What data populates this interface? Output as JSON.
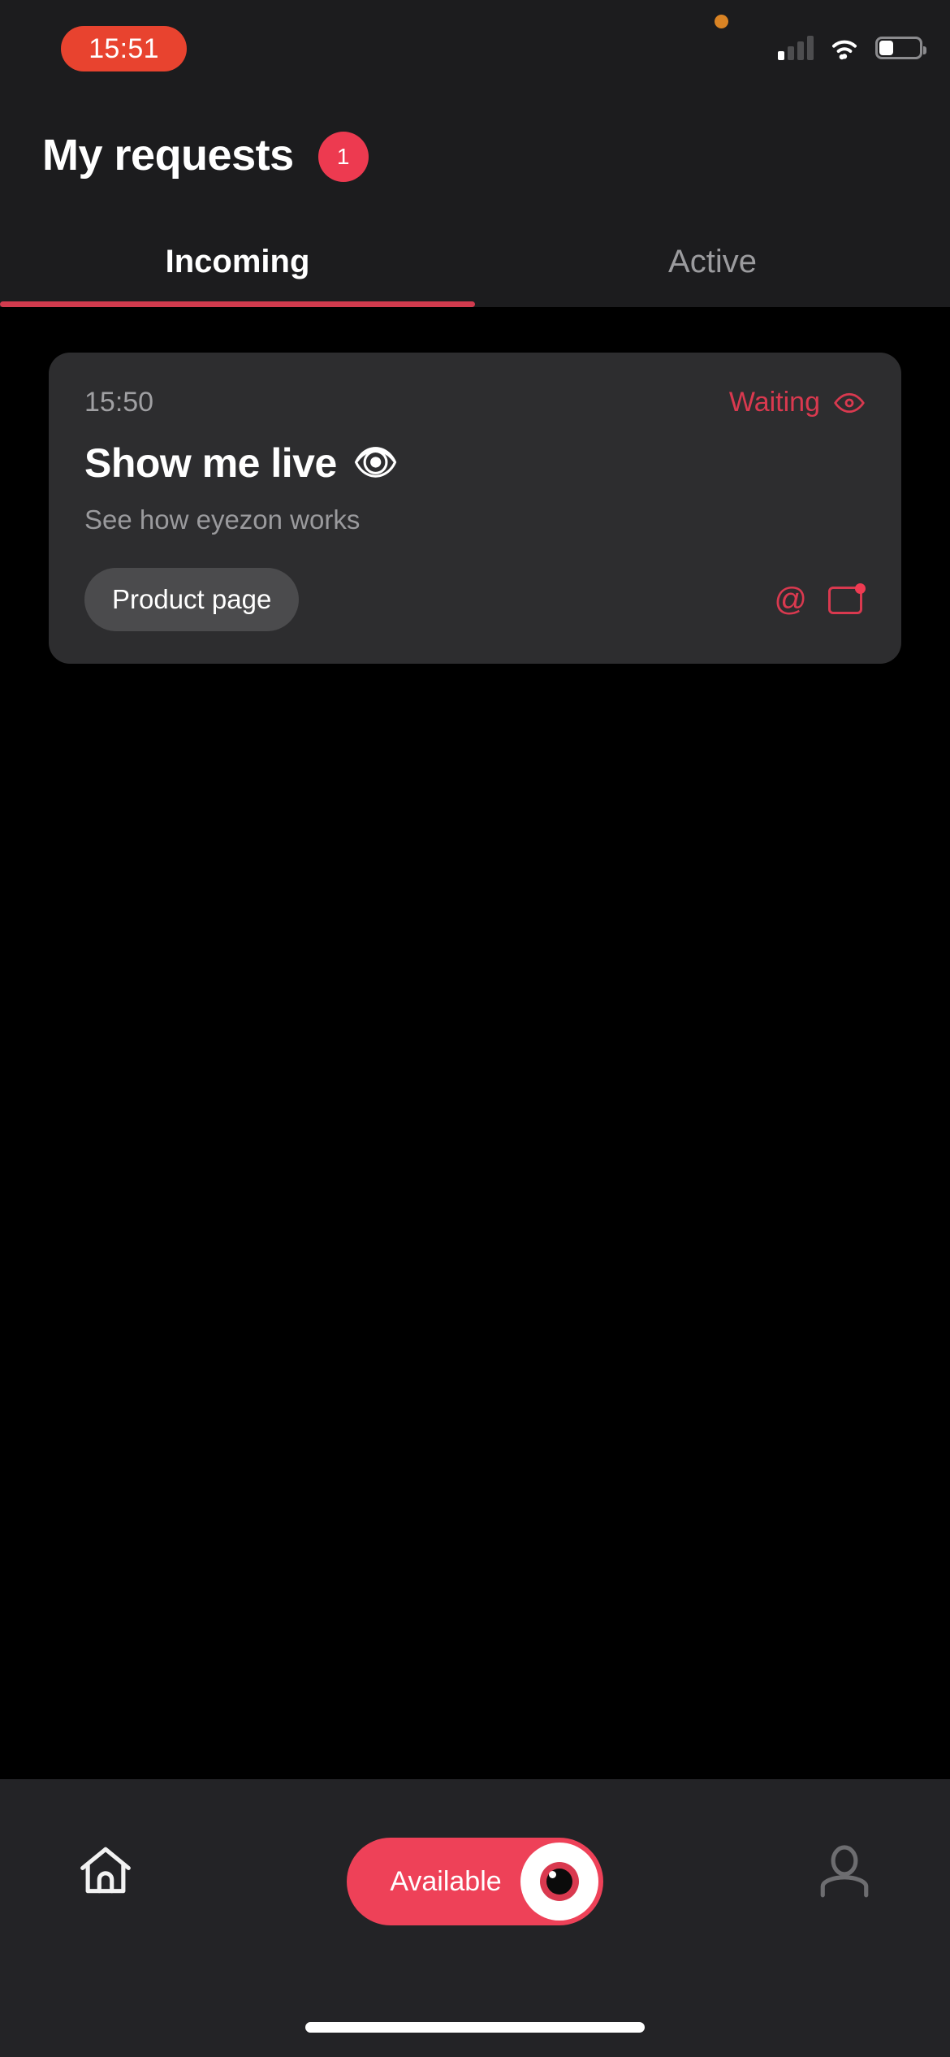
{
  "status_bar": {
    "time": "15:51",
    "privacy_indicator": "orange-dot",
    "cellular_bars_filled": 1,
    "cellular_bars_total": 4,
    "wifi": "wifi-full",
    "battery_percent": 35
  },
  "header": {
    "title": "My requests",
    "badge_count": "1",
    "tabs": [
      {
        "label": "Incoming",
        "active": true
      },
      {
        "label": "Active",
        "active": false
      }
    ]
  },
  "requests": [
    {
      "time": "15:50",
      "status": "Waiting",
      "status_icon": "eye-icon",
      "title": "Show me live",
      "title_emoji": "👁",
      "subtitle": "See how eyezon works",
      "chip_label": "Product page",
      "actions": [
        {
          "icon": "at-icon",
          "glyph": "@"
        },
        {
          "icon": "screen-share-icon",
          "has_badge": true
        }
      ]
    }
  ],
  "bottom_bar": {
    "home_icon": "home-icon",
    "profile_icon": "person-icon",
    "availability_toggle": {
      "label": "Available",
      "state": "on",
      "knob_icon": "eye-knob-icon"
    }
  },
  "colors": {
    "accent_red": "#ee4158",
    "status_red": "#d9394f",
    "tab_indicator": "#d13b4e",
    "recording_pill": "#e8432f",
    "card_bg": "#2d2d2f",
    "chip_bg": "#4b4b4d",
    "header_bg": "#1c1c1e",
    "body_bg": "#000000",
    "bottom_bar_bg": "#232326",
    "muted_text": "#9a9a9d"
  }
}
